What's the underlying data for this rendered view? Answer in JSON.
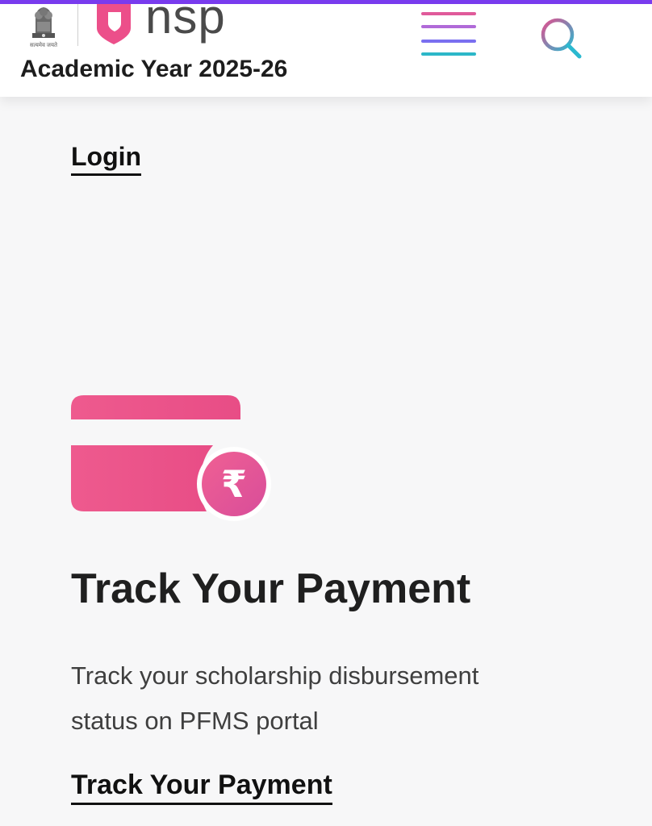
{
  "header": {
    "emblem_caption": "सत्यमेव जयते",
    "logo_text": "nsp",
    "academic_year": "Academic Year 2025-26",
    "menu_icon": "hamburger-menu-icon",
    "search_icon": "search-icon"
  },
  "login": {
    "label": "Login"
  },
  "payment": {
    "icon": "card-rupee-icon",
    "rupee_symbol": "₹",
    "title": "Track Your Payment",
    "description_line1": "Track your scholarship disbursement",
    "description_line2": "status on PFMS portal",
    "link_label": "Track Your Payment"
  },
  "colors": {
    "top_strip": "#7a3cf0",
    "brand_pink": "#ec4f8a",
    "menu_bars": [
      "#e05a9a",
      "#b06ad8",
      "#7a6ff0",
      "#2cb7c8"
    ],
    "search_gradient": [
      "#e0508f",
      "#2bb9d0"
    ]
  }
}
